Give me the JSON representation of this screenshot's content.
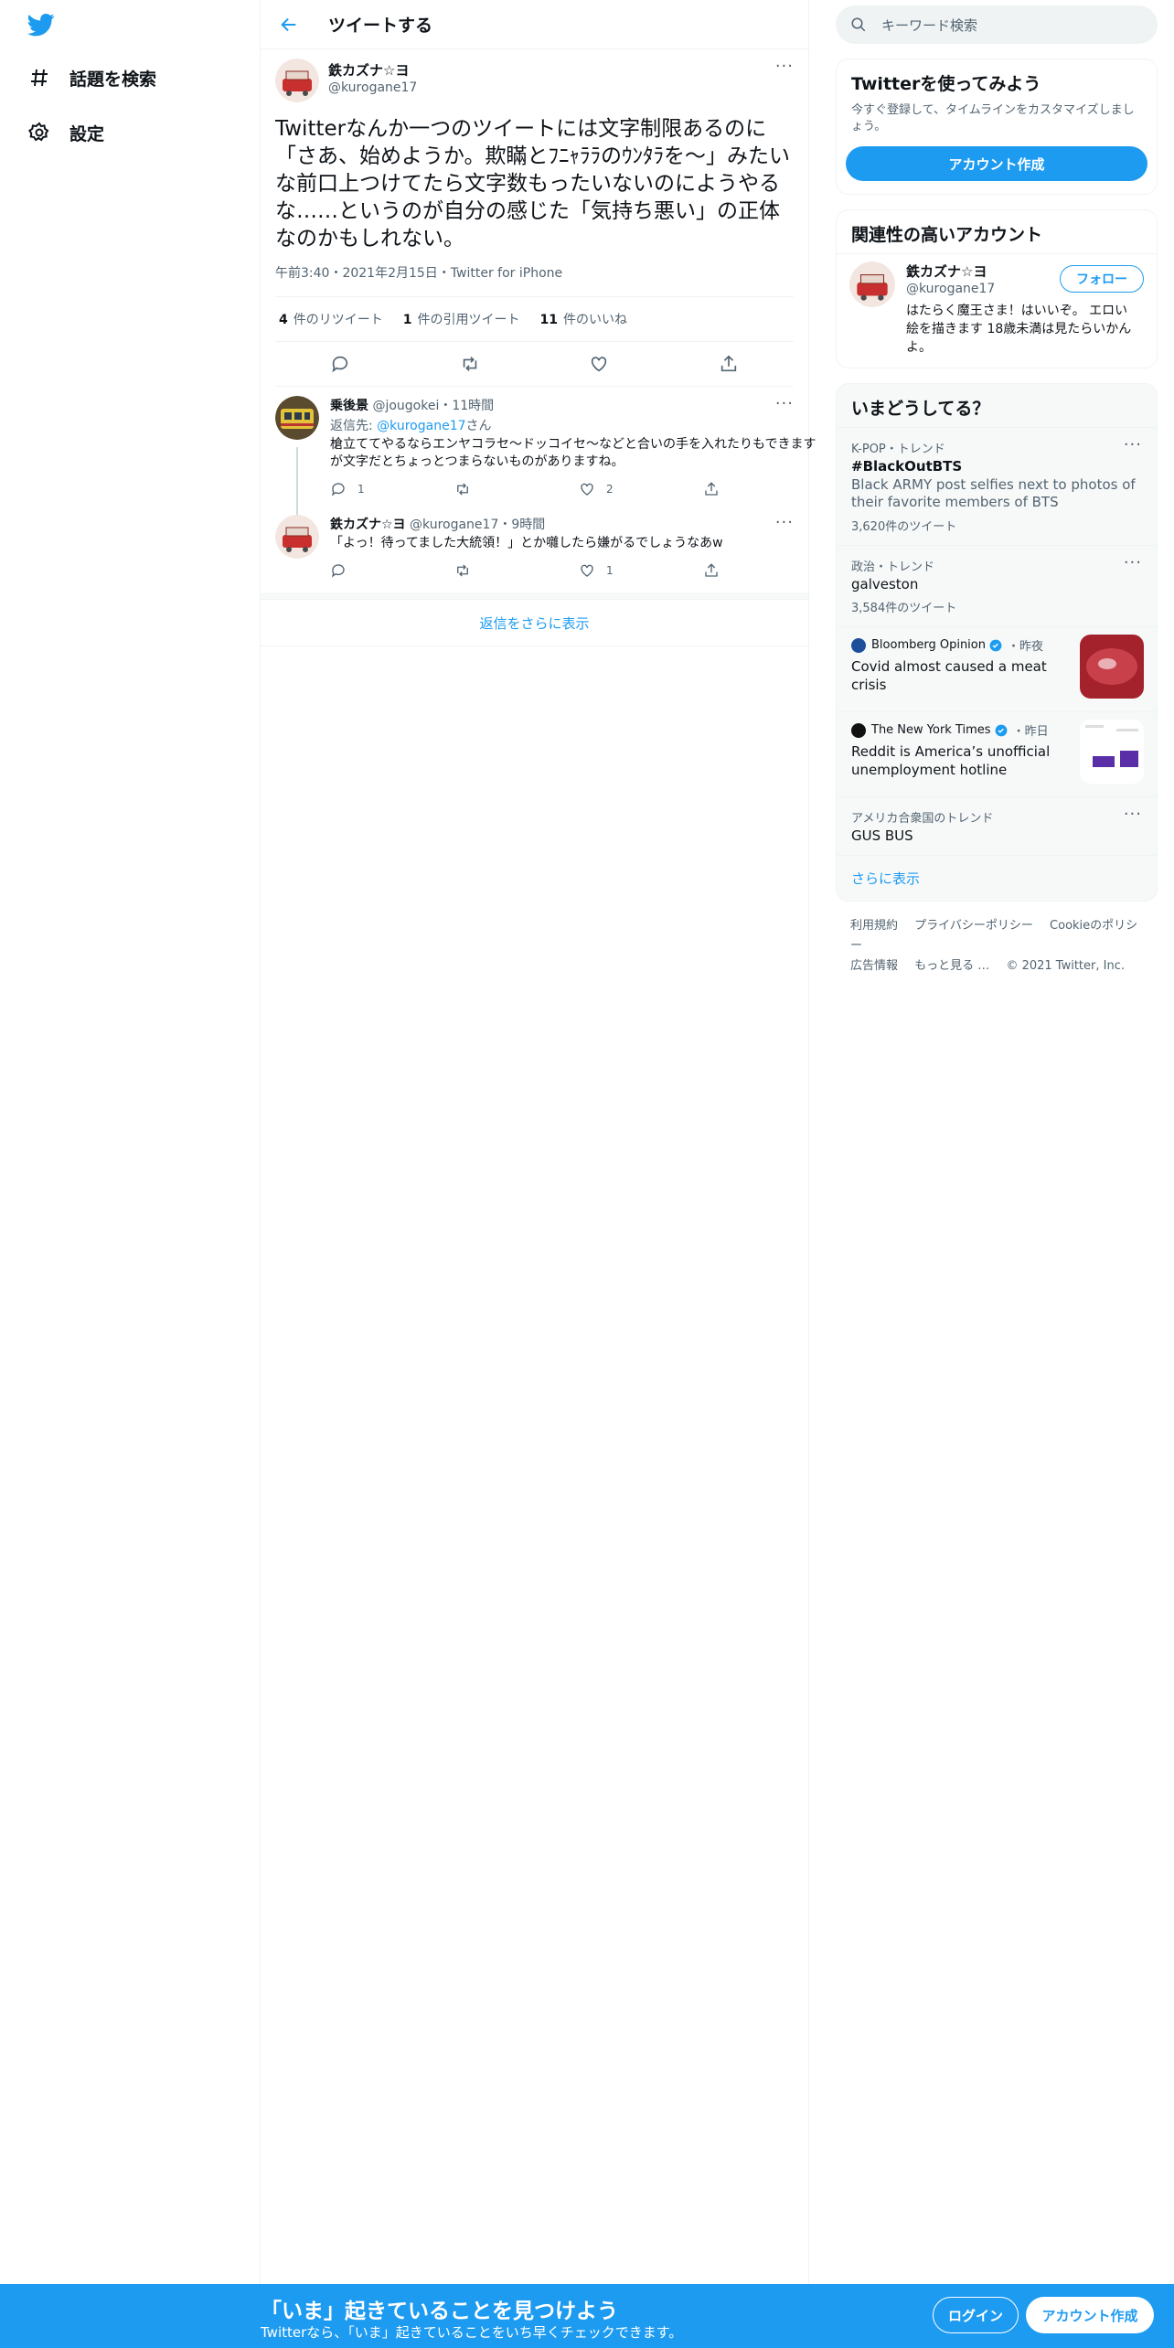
{
  "nav": {
    "items": [
      {
        "label": "話題を検索",
        "icon": "hashtag-icon"
      },
      {
        "label": "設定",
        "icon": "gear-icon"
      }
    ]
  },
  "main": {
    "title": "ツイートする",
    "tweet": {
      "display_name": "鉄カズナ☆ヨ",
      "handle": "@kurogane17",
      "text": "Twitterなんか一つのツイートには文字制限あるのに「さあ、始めようか。欺瞞とﾌﾆｬﾗﾗのｳﾝﾀﾗを〜」みたいな前口上つけてたら文字数もったいないのにようやるな……というのが自分の感じた「気持ち悪い」の正体なのかもしれない。",
      "meta": "午前3:40・2021年2月15日・Twitter for iPhone",
      "retweets_count": "4",
      "retweets_label": "件のリツイート",
      "quotes_count": "1",
      "quotes_label": "件の引用ツイート",
      "likes_count": "11",
      "likes_label": "件のいいね"
    },
    "replies": [
      {
        "display_name": "乗後景",
        "handle": "@jougokei",
        "time": "11時間",
        "reply_to_label": "返信先: ",
        "reply_to_handle": "@kurogane17",
        "reply_to_suffix": "さん",
        "text": "槍立ててやるならエンヤコラセ～ドッコイセ～などと合いの手を入れたりもできますが文字だとちょっとつまらないものがありますね。",
        "reply_count": "1",
        "retweet_count": "",
        "like_count": "2"
      },
      {
        "display_name": "鉄カズナ☆ヨ",
        "handle": "@kurogane17",
        "time": "9時間",
        "text": "「よっ！待ってました大統領！」とか囃したら嫌がるでしょうなあw",
        "reply_count": "",
        "retweet_count": "",
        "like_count": "1"
      }
    ],
    "show_more_replies": "返信をさらに表示"
  },
  "right": {
    "search_placeholder": "キーワード検索",
    "signup_card": {
      "title": "Twitterを使ってみよう",
      "subtitle": "今すぐ登録して、タイムラインをカスタマイズしましょう。",
      "button": "アカウント作成"
    },
    "relevant": {
      "title": "関連性の高いアカウント",
      "display_name": "鉄カズナ☆ヨ",
      "handle": "@kurogane17",
      "follow": "フォロー",
      "bio": "はたらく魔王さま！はいいぞ。 エロい絵を描きます 18歳未満は見たらいかんよ。"
    },
    "trends": {
      "title": "いまどうしてる？",
      "items": [
        {
          "meta": "K-POP・トレンド",
          "name": "#BlackOutBTS",
          "desc": "Black ARMY post selfies next to photos of their favorite members of BTS",
          "count": "3,620件のツイート"
        },
        {
          "meta": "政治・トレンド",
          "name": "galveston",
          "count": "3,584件のツイート"
        }
      ],
      "news": [
        {
          "source": "Bloomberg Opinion",
          "time": "・昨夜",
          "title": "Covid almost caused a meat crisis"
        },
        {
          "source": "The New York Times",
          "time": "・昨日",
          "title": "Reddit is America’s unofficial unemployment hotline"
        }
      ],
      "last": {
        "meta": "アメリカ合衆国のトレンド",
        "name": "GUS BUS"
      },
      "show_more": "さらに表示"
    },
    "footer": [
      "利用規約",
      "プライバシーポリシー",
      "Cookieのポリシー",
      "広告情報",
      "もっと見る …",
      "© 2021 Twitter, Inc."
    ]
  },
  "bottom": {
    "title": "「いま」起きていることを見つけよう",
    "subtitle": "Twitterなら、「いま」起きていることをいち早くチェックできます。",
    "login": "ログイン",
    "signup": "アカウント作成"
  },
  "colors": {
    "accent": "#1d9bf0",
    "text": "#0f1419",
    "muted": "#536471"
  }
}
